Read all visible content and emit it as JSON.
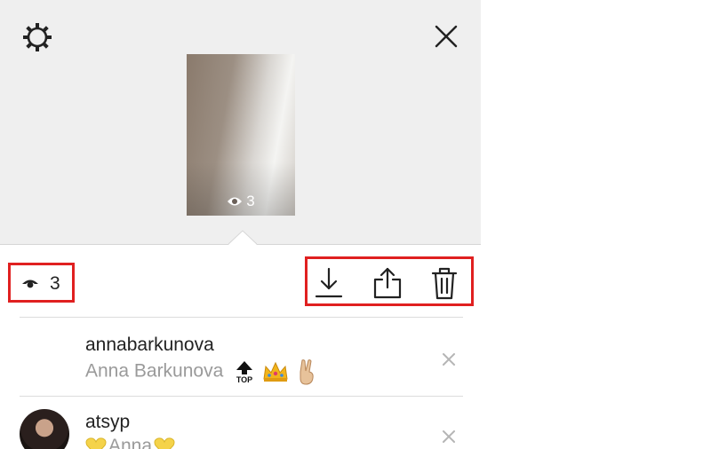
{
  "viewer": {
    "thumbnail_views": "3",
    "views_count": "3"
  },
  "viewers_list": [
    {
      "username": "annabarkunova",
      "full_name": "Anna Barkunova",
      "badges": [
        "top-arrow-icon",
        "crown-icon",
        "victory-hand-icon"
      ],
      "top_label": "TOP"
    },
    {
      "username": "atsyp",
      "full_name": "Anna",
      "badges": [
        "yellow-heart-icon",
        "yellow-heart-icon"
      ]
    }
  ],
  "colors": {
    "highlight": "#e02020",
    "top_background": "#efefef",
    "secondary_text": "#9a9a9a"
  }
}
